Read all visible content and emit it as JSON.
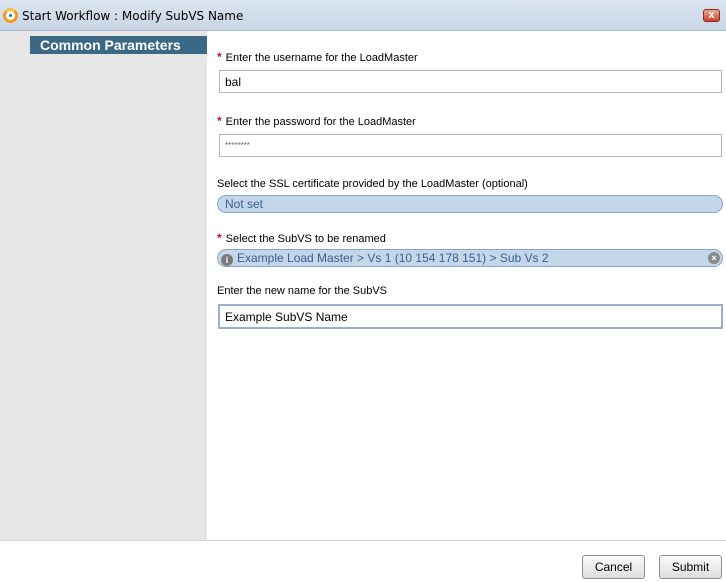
{
  "window": {
    "title": "Start Workflow : Modify SubVS Name",
    "close_label": "x"
  },
  "sidebar": {
    "section_title": "Common Parameters"
  },
  "form": {
    "username": {
      "required": true,
      "label": "Enter the username for the LoadMaster",
      "value": "bal"
    },
    "password": {
      "required": true,
      "label": "Enter the password for the LoadMaster",
      "value": "********"
    },
    "ssl_certificate": {
      "required": false,
      "label": "Select the SSL certificate provided by the LoadMaster (optional)",
      "value": "Not set"
    },
    "subvs": {
      "required": true,
      "label": "Select the SubVS to be renamed",
      "value": "Example Load Master > Vs 1 (10 154 178 151) > Sub Vs 2"
    },
    "new_name": {
      "required": false,
      "label": "Enter the new name for the SubVS",
      "value": "Example SubVS Name"
    },
    "required_marker": "*"
  },
  "footer": {
    "cancel_label": "Cancel",
    "submit_label": "Submit"
  },
  "icons": {
    "app": "workflow-app-icon",
    "close": "close-icon",
    "info": "info-icon",
    "clear": "clear-icon"
  }
}
